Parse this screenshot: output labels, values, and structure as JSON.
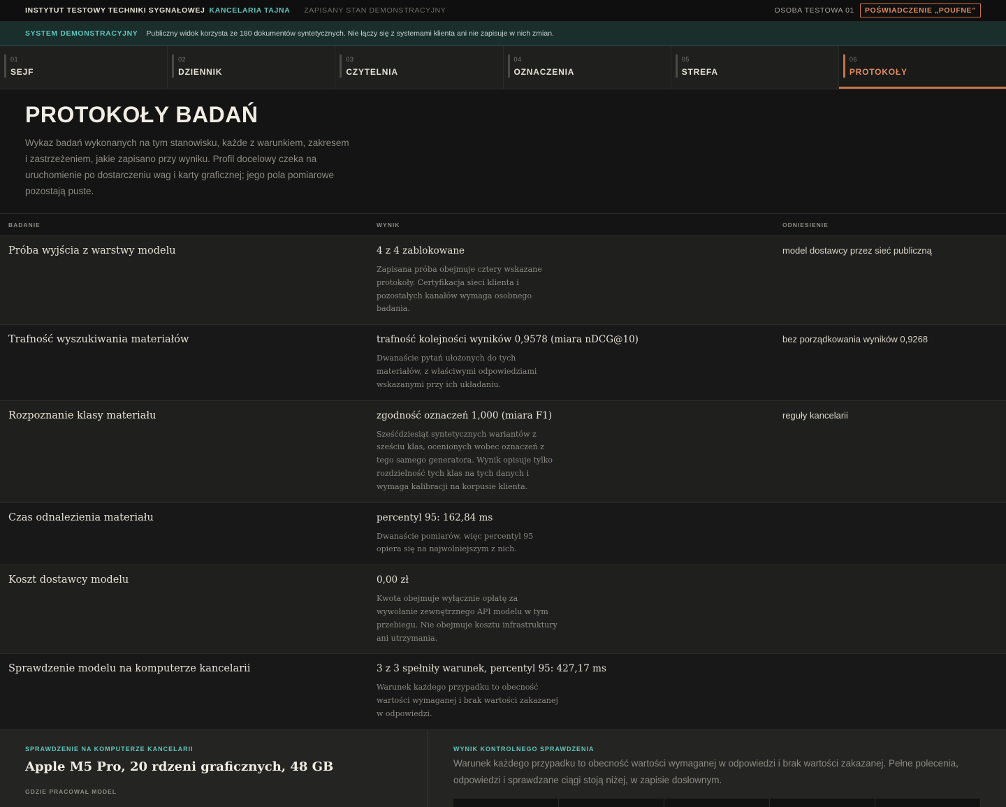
{
  "topbar": {
    "org": "INSTYTUT TESTOWY TECHNIKI SYGNAŁOWEJ",
    "dept": "KANCELARIA TAJNA",
    "state": "ZAPISANY STAN DEMONSTRACYJNY",
    "person": "OSOBA TESTOWA 01",
    "clearance": "POŚWIADCZENIE „POUFNE”"
  },
  "banner": {
    "tag": "SYSTEM DEMONSTRACYJNY",
    "message": "Publiczny widok korzysta ze 180 dokumentów syntetycznych. Nie łączy się z systemami klienta ani nie zapisuje w nich zmian."
  },
  "tabs": [
    {
      "num": "01",
      "label": "SEJF"
    },
    {
      "num": "02",
      "label": "DZIENNIK"
    },
    {
      "num": "03",
      "label": "CZYTELNIA"
    },
    {
      "num": "04",
      "label": "OZNACZENIA"
    },
    {
      "num": "05",
      "label": "STREFA"
    },
    {
      "num": "06",
      "label": "PROTOKOŁY",
      "active": true
    }
  ],
  "hero": {
    "title": "PROTOKOŁY BADAŃ",
    "description": "Wykaz badań wykonanych na tym stanowisku, każde z warunkiem, zakresem i zastrzeżeniem, jakie zapisano przy wyniku. Profil docelowy czeka na uruchomienie po dostarczeniu wag i karty graficznej; jego pola pomiarowe pozostają puste."
  },
  "table": {
    "headers": {
      "name": "BADANIE",
      "result": "WYNIK",
      "reference": "ODNIESIENIE"
    },
    "rows": [
      {
        "name": "Próba wyjścia z warstwy modelu",
        "result": "4 z 4 zablokowane",
        "note": "Zapisana próba obejmuje cztery wskazane protokoły. Certyfikacja sieci klienta i pozostałych kanałów wymaga osobnego badania.",
        "reference": "model dostawcy przez sieć publiczną"
      },
      {
        "name": "Trafność wyszukiwania materiałów",
        "result": "trafność kolejności wyników 0,9578 (miara nDCG@10)",
        "note": "Dwanaście pytań ułożonych do tych materiałów, z właściwymi odpowiedziami wskazanymi przy ich układaniu.",
        "reference": "bez porządkowania wyników 0,9268"
      },
      {
        "name": "Rozpoznanie klasy materiału",
        "result": "zgodność oznaczeń 1,000 (miara F1)",
        "note": "Sześćdziesiąt syntetycznych wariantów z sześciu klas, ocenionych wobec oznaczeń z tego samego generatora. Wynik opisuje tylko rozdzielność tych klas na tych danych i wymaga kalibracji na korpusie klienta.",
        "reference": "reguły kancelarii"
      },
      {
        "name": "Czas odnalezienia materiału",
        "result": "percentyl 95: 162,84 ms",
        "note": "Dwanaście pomiarów, więc percentyl 95 opiera się na najwolniejszym z nich.",
        "reference": ""
      },
      {
        "name": "Koszt dostawcy modelu",
        "result": "0,00 zł",
        "note": "Kwota obejmuje wyłącznie opłatę za wywołanie zewnętrznego API modelu w tym przebiegu. Nie obejmuje kosztu infrastruktury ani utrzymania.",
        "reference": ""
      },
      {
        "name": "Sprawdzenie modelu na komputerze kancelarii",
        "result": "3 z 3 spełniły warunek, percentyl 95: 427,17 ms",
        "note": "Warunek każdego przypadku to obecność wartości wymaganej i brak wartości zakazanej w odpowiedzi.",
        "reference": ""
      }
    ]
  },
  "footer": {
    "left_label": "SPRAWDZENIE NA KOMPUTERZE KANCELARII",
    "left_head": "Apple M5 Pro, 20 rdzeni graficznych, 48 GB",
    "left_sub": "GDZIE PRACOWAŁ MODEL",
    "right_label": "WYNIK KONTROLNEGO SPRAWDZENIA",
    "right_text": "Warunek każdego przypadku to obecność wartości wymaganej w odpowiedzi i brak wartości zakazanej. Pełne polecenia, odpowiedzi i sprawdzane ciągi stoją niżej, w zapisie dosłownym."
  }
}
